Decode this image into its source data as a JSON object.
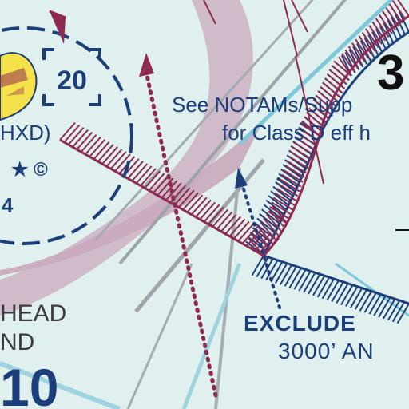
{
  "map": {
    "background": "#dff0ee",
    "colors": {
      "navy": "#1c3f7c",
      "magenta": "#8f2a52",
      "mauve_band": "#c9a9bd",
      "gray_road": "#9ea2ab",
      "light_blue": "#7ec8d8",
      "airport_yellow": "#f5e24a",
      "black": "#111111"
    },
    "labels": {
      "notams_line1": "See NOTAMs/Supp",
      "notams_line2": "for Class D eff h",
      "exclude_line1": "EXCLUDE",
      "exclude_line2": "3000’ AN",
      "airport_id": "HXD)",
      "airport_elev_partial": "4",
      "airport_symbols": "★ ©",
      "place_line1": "HEAD",
      "place_line2": "ND",
      "grid_number": "10",
      "box_number": "20",
      "top_right_number": "3"
    },
    "icons": [
      "airport-symbol-icon",
      "star-icon",
      "ctaf-circle-icon",
      "box-bracket-icon"
    ]
  }
}
